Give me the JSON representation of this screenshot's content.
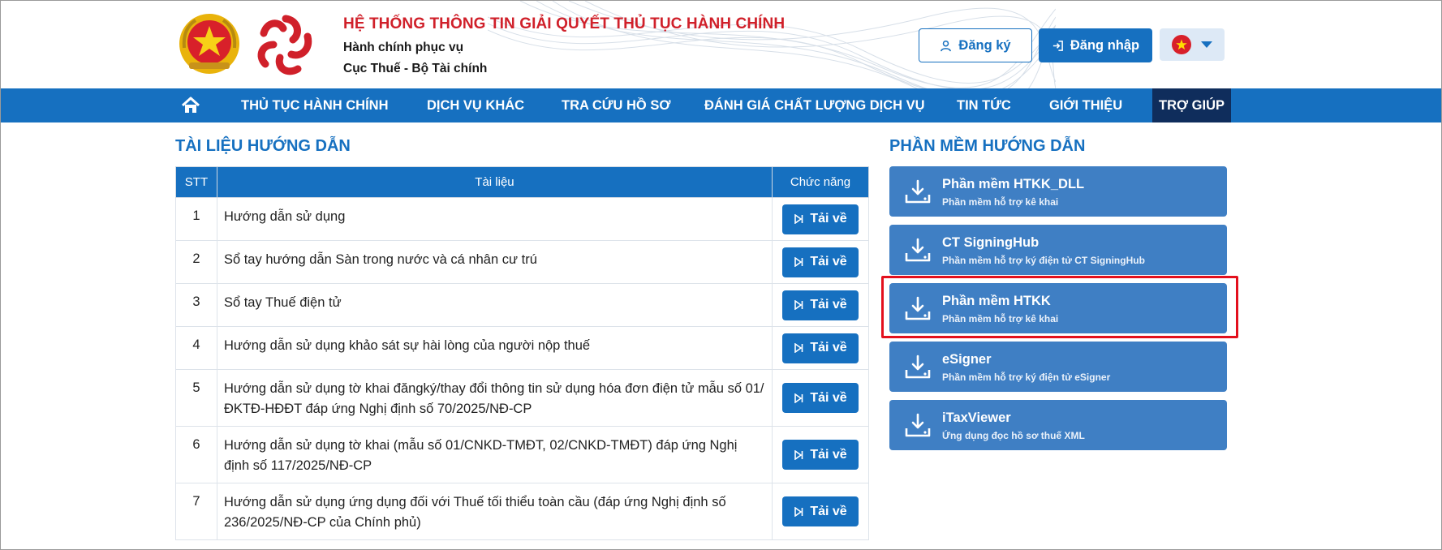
{
  "header": {
    "title": "HỆ THỐNG THÔNG TIN GIẢI QUYẾT THỦ TỤC HÀNH CHÍNH",
    "subtitle1": "Hành chính phục vụ",
    "subtitle2": "Cục Thuế - Bộ Tài chính",
    "register_label": "Đăng ký",
    "login_label": "Đăng nhập",
    "language_flag": "vietnam-flag"
  },
  "nav": {
    "items": [
      {
        "label": "THỦ TỤC HÀNH CHÍNH"
      },
      {
        "label": "DỊCH VỤ KHÁC"
      },
      {
        "label": "TRA CỨU HỒ SƠ"
      },
      {
        "label": "ĐÁNH GIÁ CHẤT LƯỢNG DỊCH VỤ"
      },
      {
        "label": "TIN TỨC"
      },
      {
        "label": "GIỚI THIỆU"
      },
      {
        "label": "TRỢ GIÚP",
        "active": true
      }
    ]
  },
  "documents": {
    "title": "TÀI LIỆU HƯỚNG DẪN",
    "columns": [
      "STT",
      "Tài liệu",
      "Chức năng"
    ],
    "download_label": "Tải về",
    "rows": [
      {
        "stt": "1",
        "name": "Hướng dẫn sử dụng"
      },
      {
        "stt": "2",
        "name": "Sổ tay hướng dẫn Sàn trong nước và cá nhân cư trú"
      },
      {
        "stt": "3",
        "name": "Sổ tay Thuế điện tử"
      },
      {
        "stt": "4",
        "name": "Hướng dẫn sử dụng khảo sát sự hài lòng của người nộp thuế"
      },
      {
        "stt": "5",
        "name": "Hướng dẫn sử dụng tờ khai đăngký/thay đổi thông tin sử dụng hóa đơn điện tử mẫu số 01/ĐKTĐ-HĐĐT đáp ứng Nghị định số 70/2025/NĐ-CP"
      },
      {
        "stt": "6",
        "name": "Hướng dẫn sử dụng tờ khai (mẫu số 01/CNKD-TMĐT, 02/CNKD-TMĐT) đáp ứng Nghị định số 117/2025/NĐ-CP"
      },
      {
        "stt": "7",
        "name": "Hướng dẫn sử dụng ứng dụng đối với Thuế tối thiểu toàn cầu (đáp ứng Nghị định số 236/2025/NĐ-CP của Chính phủ)"
      }
    ]
  },
  "software": {
    "title": "PHẦN MỀM HƯỚNG DẪN",
    "items": [
      {
        "name": "Phần mềm HTKK_DLL",
        "desc": "Phần mềm hỗ trợ kê khai"
      },
      {
        "name": "CT SigningHub",
        "desc": "Phần mềm hỗ trợ ký điện tử CT SigningHub"
      },
      {
        "name": "Phần mềm HTKK",
        "desc": "Phần mềm hỗ trợ kê khai",
        "highlighted": true
      },
      {
        "name": "eSigner",
        "desc": "Phần mềm hỗ trợ ký điện tử eSigner"
      },
      {
        "name": "iTaxViewer",
        "desc": "Ứng dụng đọc hồ sơ thuế XML"
      }
    ]
  },
  "colors": {
    "primary": "#1670c0",
    "nav_active": "#0f2d5c",
    "title_red": "#d0202a",
    "card_blue": "#3f7fc4",
    "highlight_red": "#e3101d"
  }
}
